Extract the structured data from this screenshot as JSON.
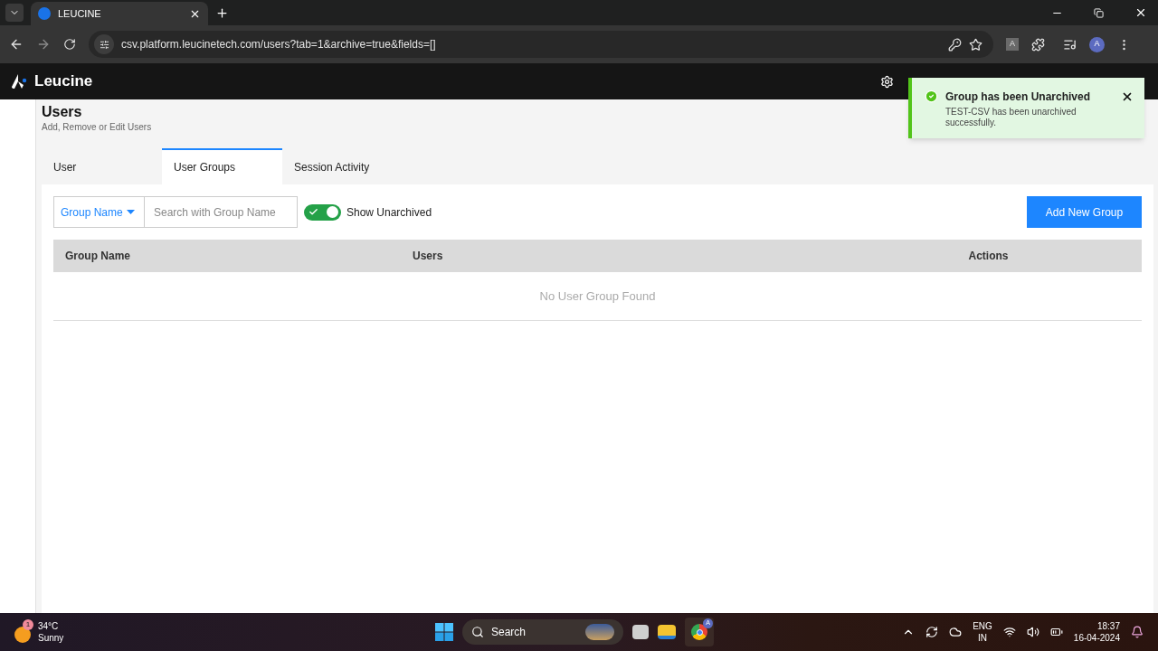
{
  "browser": {
    "tab_title": "LEUCINE",
    "url": "csv.platform.leucinetech.com/users?tab=1&archive=true&fields=[]",
    "profile_initial": "A",
    "translate_label": "A"
  },
  "app": {
    "brand": "Leucine"
  },
  "toast": {
    "title": "Group has been Unarchived",
    "message": "TEST-CSV has been unarchived successfully."
  },
  "page": {
    "title": "Users",
    "subtitle": "Add, Remove or Edit Users"
  },
  "tabs": [
    {
      "label": "User",
      "selected": false
    },
    {
      "label": "User Groups",
      "selected": true
    },
    {
      "label": "Session Activity",
      "selected": false
    }
  ],
  "filter": {
    "field": "Group Name",
    "placeholder": "Search with Group Name"
  },
  "toggle": {
    "label": "Show Unarchived",
    "on": true
  },
  "add_button": "Add New Group",
  "table": {
    "columns": [
      "Group Name",
      "Users",
      "Actions"
    ],
    "empty": "No User Group Found"
  },
  "taskbar": {
    "temperature": "34°C",
    "weather": "Sunny",
    "weather_badge": "1",
    "search": "Search",
    "language": "ENG",
    "region": "IN",
    "time": "18:37",
    "date": "16-04-2024",
    "chrome_badge": "A"
  }
}
